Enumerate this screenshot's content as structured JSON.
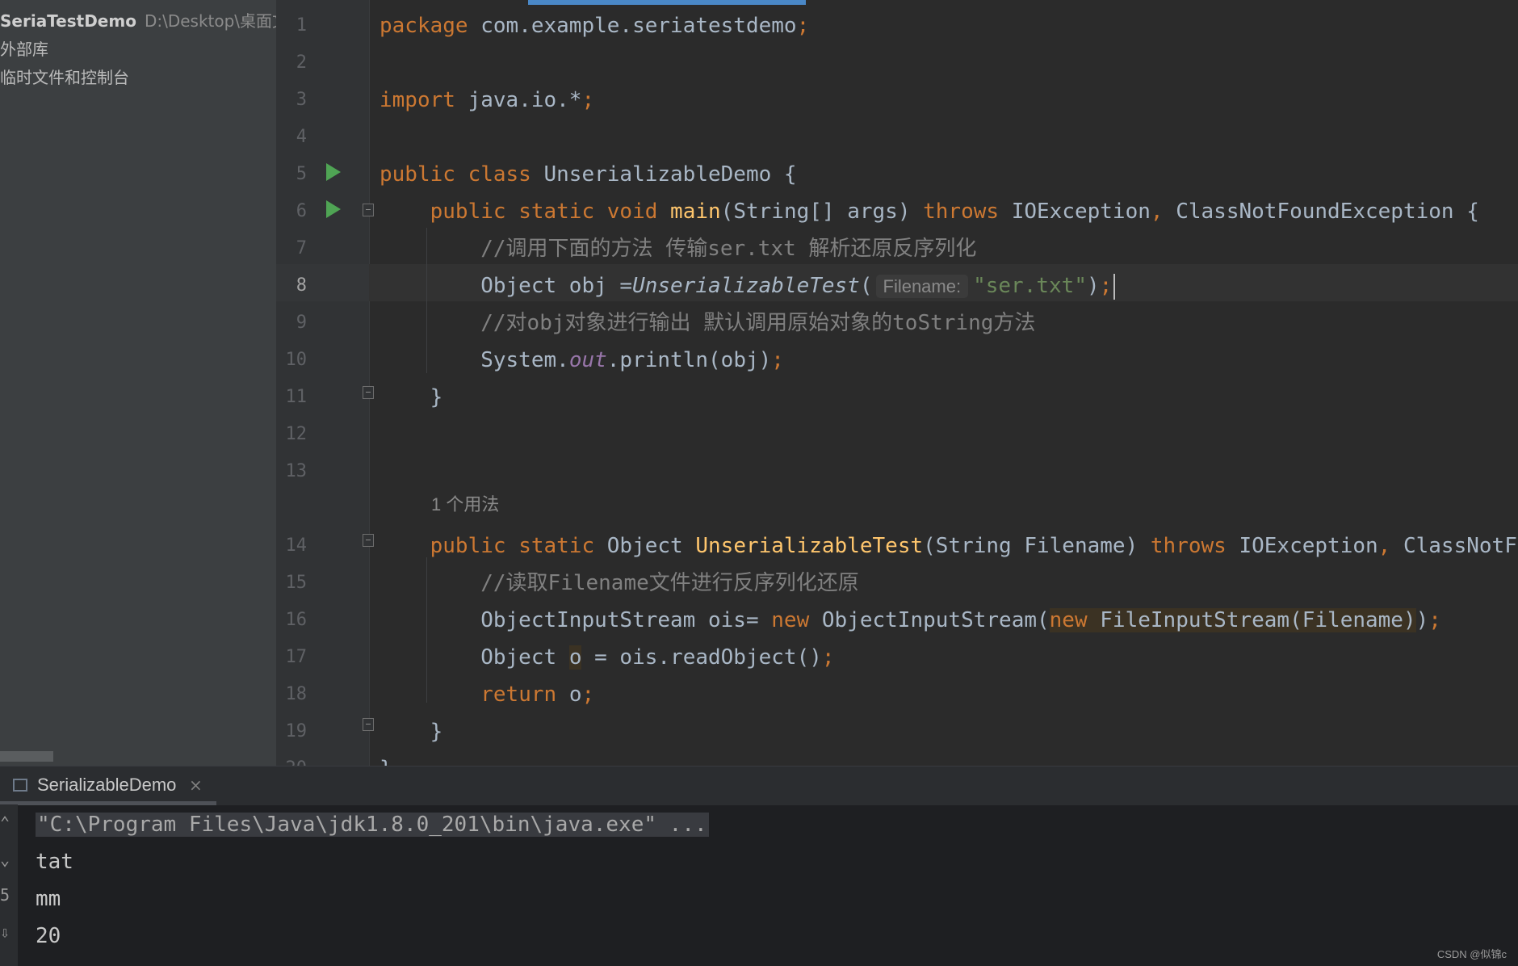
{
  "project": {
    "name": "SeriaTestDemo",
    "path": "D:\\Desktop\\桌面文",
    "items": [
      "外部库",
      "临时文件和控制台"
    ]
  },
  "editor": {
    "current_line": 8,
    "usage_hint": "1 个用法",
    "param_hint": "Filename:",
    "lines": [
      {
        "n": "1",
        "segs": [
          {
            "c": "kw",
            "t": "package "
          },
          {
            "c": "",
            "t": "com.example.seriatestdemo"
          },
          {
            "c": "kw",
            "t": ";"
          }
        ]
      },
      {
        "n": "2",
        "segs": []
      },
      {
        "n": "3",
        "segs": [
          {
            "c": "kw",
            "t": "import "
          },
          {
            "c": "",
            "t": "java.io.*"
          },
          {
            "c": "kw",
            "t": ";"
          }
        ]
      },
      {
        "n": "4",
        "segs": []
      },
      {
        "n": "5",
        "segs": [
          {
            "c": "kw",
            "t": "public class "
          },
          {
            "c": "",
            "t": "UnserializableDemo {"
          }
        ]
      },
      {
        "n": "6",
        "segs": [
          {
            "c": "",
            "t": "    "
          },
          {
            "c": "kw",
            "t": "public static void "
          },
          {
            "c": "fn",
            "t": "main"
          },
          {
            "c": "",
            "t": "(String[] args) "
          },
          {
            "c": "kw",
            "t": "throws "
          },
          {
            "c": "",
            "t": "IOException"
          },
          {
            "c": "kw",
            "t": ", "
          },
          {
            "c": "",
            "t": "ClassNotFoundException {"
          }
        ]
      },
      {
        "n": "7",
        "segs": [
          {
            "c": "",
            "t": "        "
          },
          {
            "c": "cmt",
            "t": "//调用下面的方法 传输ser.txt 解析还原反序列化"
          }
        ]
      },
      {
        "n": "8",
        "segs": [
          {
            "c": "",
            "t": "        Object obj ="
          },
          {
            "c": "static-call",
            "t": "UnserializableTest"
          },
          {
            "c": "",
            "t": "("
          },
          {
            "c": "hint",
            "t": "Filename:"
          },
          {
            "c": "str",
            "t": "\"ser.txt\""
          },
          {
            "c": "",
            "t": ")"
          },
          {
            "c": "kw",
            "t": ";"
          },
          {
            "c": "caret",
            "t": ""
          }
        ]
      },
      {
        "n": "9",
        "segs": [
          {
            "c": "",
            "t": "        "
          },
          {
            "c": "cmt",
            "t": "//对obj对象进行输出 默认调用原始对象的toString方法"
          }
        ]
      },
      {
        "n": "10",
        "segs": [
          {
            "c": "",
            "t": "        System."
          },
          {
            "c": "field",
            "t": "out"
          },
          {
            "c": "",
            "t": ".println(obj)"
          },
          {
            "c": "kw",
            "t": ";"
          }
        ]
      },
      {
        "n": "11",
        "segs": [
          {
            "c": "",
            "t": "    }"
          }
        ]
      },
      {
        "n": "12",
        "segs": []
      },
      {
        "n": "13",
        "segs": []
      },
      {
        "n": "14",
        "segs": [
          {
            "c": "",
            "t": "    "
          },
          {
            "c": "kw",
            "t": "public static "
          },
          {
            "c": "",
            "t": "Object "
          },
          {
            "c": "fn",
            "t": "UnserializableTest"
          },
          {
            "c": "",
            "t": "(String Filename) "
          },
          {
            "c": "kw",
            "t": "throws "
          },
          {
            "c": "",
            "t": "IOException"
          },
          {
            "c": "kw",
            "t": ", "
          },
          {
            "c": "",
            "t": "ClassNotFoundException {"
          }
        ]
      },
      {
        "n": "15",
        "segs": [
          {
            "c": "",
            "t": "        "
          },
          {
            "c": "cmt",
            "t": "//读取Filename文件进行反序列化还原"
          }
        ]
      },
      {
        "n": "16",
        "segs": [
          {
            "c": "",
            "t": "        ObjectInputStream ois= "
          },
          {
            "c": "kw",
            "t": "new "
          },
          {
            "c": "",
            "t": "ObjectInputStream("
          },
          {
            "c": "hl kw",
            "t": "new "
          },
          {
            "c": "hl",
            "t": "FileInputStream(Filename)"
          },
          {
            "c": "",
            "t": ")"
          },
          {
            "c": "kw",
            "t": ";"
          }
        ]
      },
      {
        "n": "17",
        "segs": [
          {
            "c": "",
            "t": "        Object "
          },
          {
            "c": "hl",
            "t": "o"
          },
          {
            "c": "",
            "t": " = ois.readObject()"
          },
          {
            "c": "kw",
            "t": ";"
          }
        ]
      },
      {
        "n": "18",
        "segs": [
          {
            "c": "",
            "t": "        "
          },
          {
            "c": "kw",
            "t": "return "
          },
          {
            "c": "",
            "t": "o"
          },
          {
            "c": "kw",
            "t": ";"
          }
        ]
      },
      {
        "n": "19",
        "segs": [
          {
            "c": "",
            "t": "    }"
          }
        ]
      },
      {
        "n": "20",
        "segs": [
          {
            "c": "",
            "t": "}"
          }
        ]
      }
    ]
  },
  "run_panel": {
    "tab_label": "SerializableDemo",
    "close_glyph": "×",
    "toolbar_glyphs": [
      "⌃",
      "⌄",
      "5",
      "⇩"
    ],
    "output": [
      "\"C:\\Program Files\\Java\\jdk1.8.0_201\\bin\\java.exe\" ...",
      "tat",
      "mm",
      "20"
    ]
  },
  "watermark": "CSDN @似锦c"
}
